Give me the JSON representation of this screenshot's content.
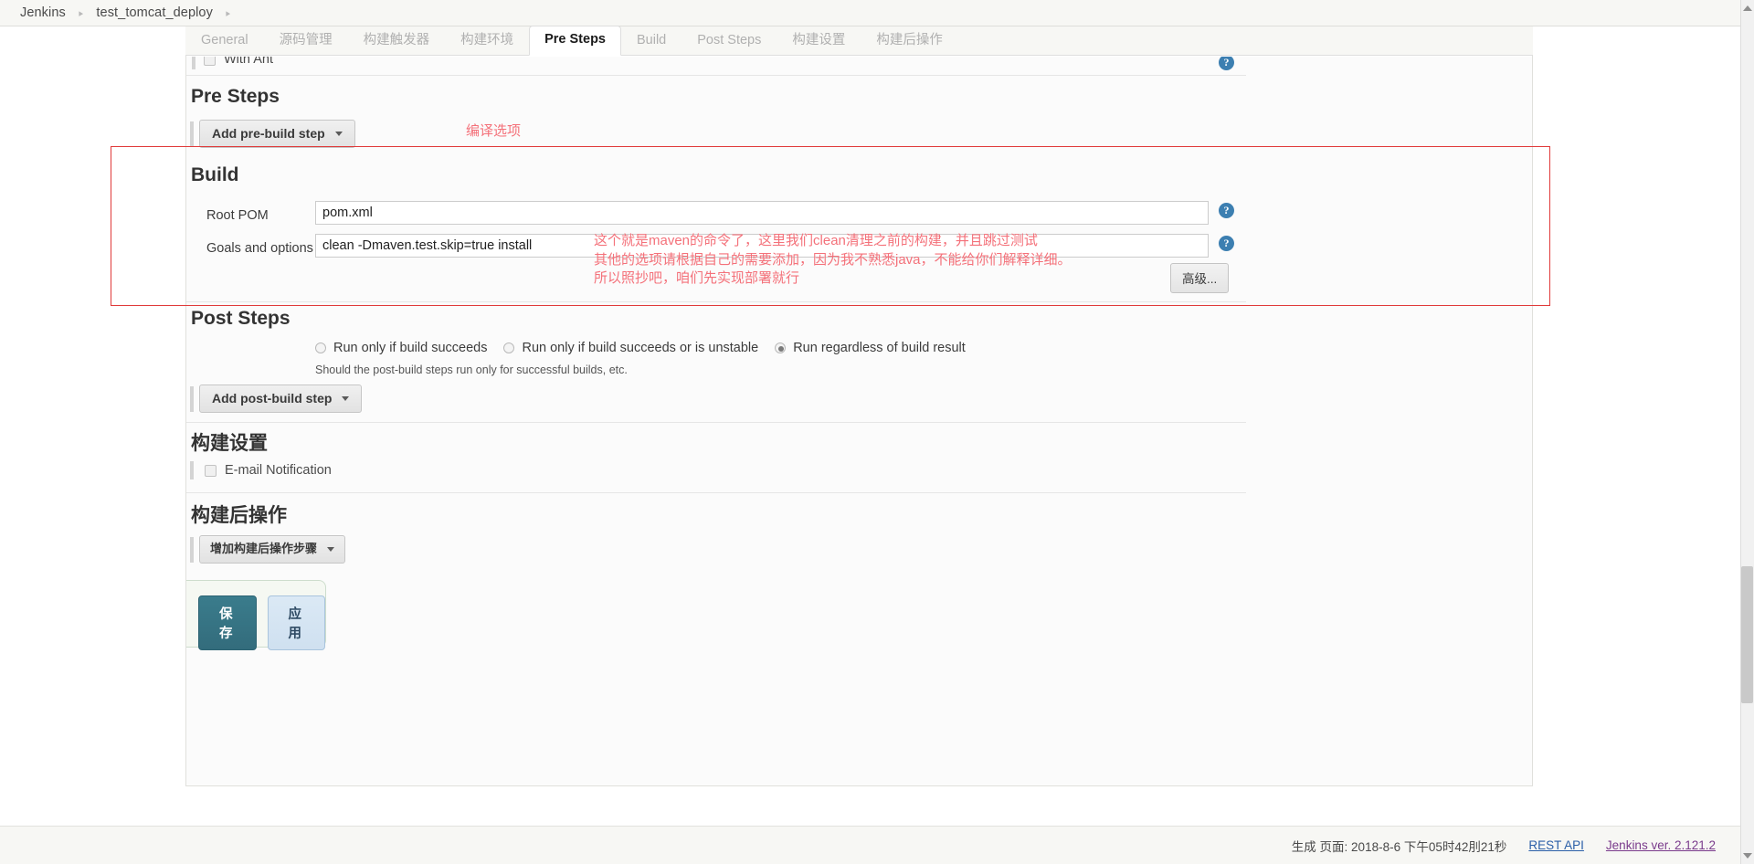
{
  "breadcrumb": {
    "items": [
      "Jenkins",
      "test_tomcat_deploy"
    ],
    "separator": "▸"
  },
  "tabs": [
    {
      "label": "General",
      "active": false
    },
    {
      "label": "源码管理",
      "active": false
    },
    {
      "label": "构建触发器",
      "active": false
    },
    {
      "label": "构建环境",
      "active": false
    },
    {
      "label": "Pre Steps",
      "active": true
    },
    {
      "label": "Build",
      "active": false
    },
    {
      "label": "Post Steps",
      "active": false
    },
    {
      "label": "构建设置",
      "active": false
    },
    {
      "label": "构建后操作",
      "active": false
    }
  ],
  "with_ant": {
    "label": "With Ant"
  },
  "pre_steps": {
    "title": "Pre Steps",
    "add_button": "Add pre-build step",
    "annotation": "编译选项"
  },
  "build": {
    "title": "Build",
    "root_pom_label": "Root POM",
    "root_pom_value": "pom.xml",
    "goals_label": "Goals and options",
    "goals_value": "clean -Dmaven.test.skip=true install",
    "advanced_button": "高级...",
    "annotation_lines": [
      "这个就是maven的命令了，这里我们clean清理之前的构建，并且跳过测试",
      "其他的选项请根据自己的需要添加，因为我不熟悉java，不能给你们解释详细。",
      "所以照抄吧，咱们先实现部署就行"
    ]
  },
  "post_steps": {
    "title": "Post Steps",
    "radios": [
      {
        "label": "Run only if build succeeds",
        "checked": false
      },
      {
        "label": "Run only if build succeeds or is unstable",
        "checked": false
      },
      {
        "label": "Run regardless of build result",
        "checked": true
      }
    ],
    "hint": "Should the post-build steps run only for successful builds, etc.",
    "add_button": "Add post-build step"
  },
  "build_settings": {
    "title": "构建设置",
    "email_notification_label": "E-mail Notification",
    "email_notification_checked": false
  },
  "post_build_actions": {
    "title": "构建后操作",
    "add_button": "增加构建后操作步骤"
  },
  "actions": {
    "save_label": "保存",
    "apply_label": "应用"
  },
  "footer": {
    "generated_text": "生成 页面: 2018-8-6 下午05时42刖21秒",
    "rest_api_link": "REST API",
    "version_link": "Jenkins ver. 2.121.2"
  },
  "colors": {
    "annotation_red": "#f4717a",
    "highlight_box": "#e03a3a",
    "help_blue": "#3c7fb1",
    "save_teal": "#3a7c8c",
    "apply_blue": "#cfe0f0"
  },
  "icons": {
    "help": "?",
    "caret_down": "▾"
  }
}
